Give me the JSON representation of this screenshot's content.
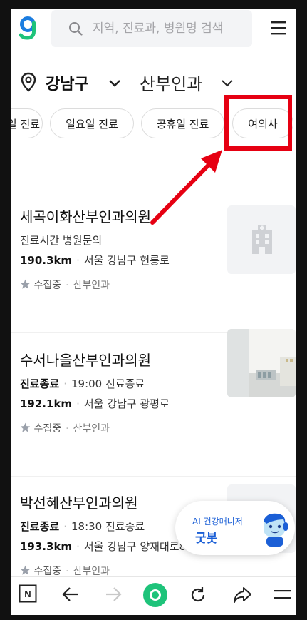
{
  "search": {
    "placeholder": "지역, 진료과, 병원명 검색"
  },
  "location": {
    "region": "강남구",
    "department": "산부인과"
  },
  "chips": [
    "일 진료",
    "일요일 진료",
    "공휴일 진료",
    "여의사"
  ],
  "hospitals": [
    {
      "name": "세곡이화산부인과의원",
      "status": "진료시간 병원문의",
      "status_time": "",
      "distance": "190.3km",
      "address": "서울 강남구 헌릉로",
      "rating": "수집중",
      "category": "산부인과"
    },
    {
      "name": "수서나을산부인과의원",
      "status": "진료종료",
      "status_time": "19:00 진료종료",
      "distance": "192.1km",
      "address": "서울 강남구 광평로",
      "rating": "수집중",
      "category": "산부인과"
    },
    {
      "name": "박선혜산부인과의원",
      "status": "진료종료",
      "status_time": "18:30 진료종료",
      "distance": "193.3km",
      "address": "서울 강남구 양재대로8",
      "rating": "수집중",
      "category": "산부인과"
    }
  ],
  "ai_assistant": {
    "label_small": "AI 건강매니저",
    "label_big": "굿봇"
  },
  "colors": {
    "brand_green": "#1ec37a",
    "brand_blue": "#1b5fd6",
    "highlight_red": "#e60012"
  },
  "icons": [
    "logo-icon",
    "search-icon",
    "menu-icon",
    "location-pin-icon",
    "chevron-down-icon",
    "star-icon",
    "hospital-building-icon",
    "naver-icon",
    "back-icon",
    "forward-icon",
    "home-icon",
    "refresh-icon",
    "share-icon",
    "tabs-menu-icon"
  ]
}
